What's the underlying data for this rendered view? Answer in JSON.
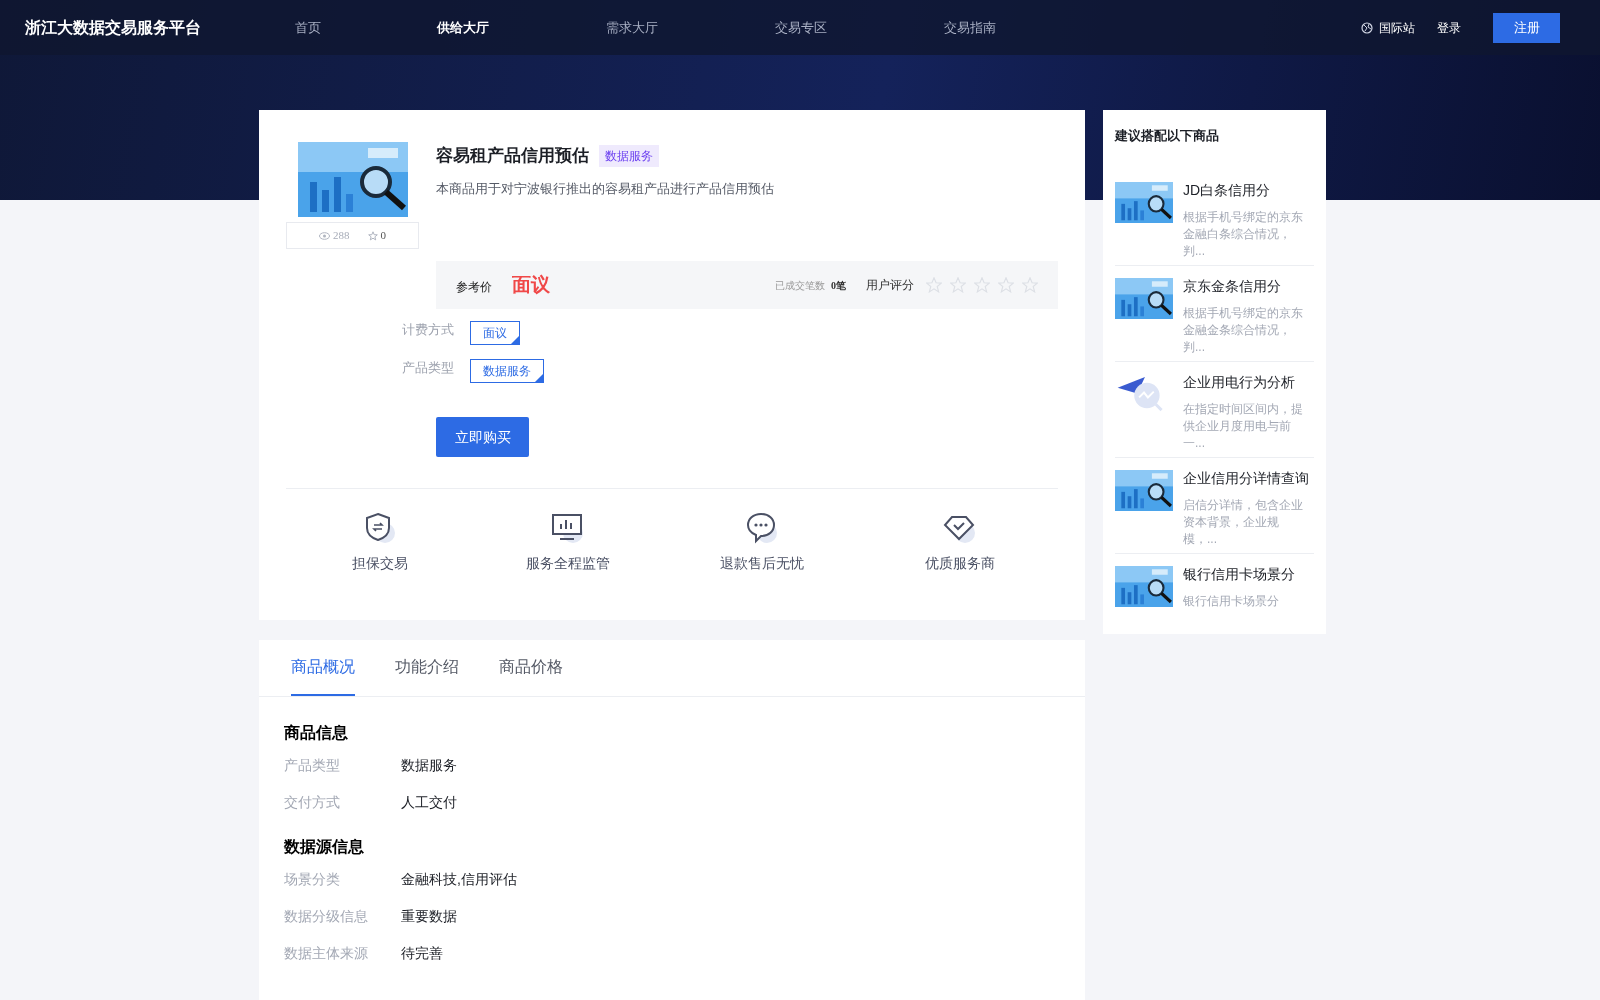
{
  "header": {
    "logo": "浙江大数据交易服务平台",
    "nav": [
      {
        "label": "首页",
        "selected": false
      },
      {
        "label": "供给大厅",
        "selected": true
      },
      {
        "label": "需求大厅",
        "selected": false
      },
      {
        "label": "交易专区",
        "selected": false
      },
      {
        "label": "交易指南",
        "selected": false
      }
    ],
    "intl": "国际站",
    "login": "登录",
    "register": "注册"
  },
  "product": {
    "title": "容易租产品信用预估",
    "badge": "数据服务",
    "description": "本商品用于对宁波银行推出的容易租产品进行产品信用预估",
    "views": "288",
    "favorites": "0",
    "price_label": "参考价",
    "price": "面议",
    "deals_label": "已成交笔数",
    "deals": "0笔",
    "rating_label": "用户评分",
    "stars": 0,
    "options": [
      {
        "label": "计费方式",
        "value": "面议"
      },
      {
        "label": "产品类型",
        "value": "数据服务"
      }
    ],
    "buy": "立即购买",
    "features": [
      {
        "kind": "shield",
        "label": "担保交易"
      },
      {
        "kind": "monitor",
        "label": "服务全程监管"
      },
      {
        "kind": "chat",
        "label": "退款售后无忧"
      },
      {
        "kind": "diamond",
        "label": "优质服务商"
      }
    ]
  },
  "tabs": [
    {
      "label": "商品概况",
      "selected": true
    },
    {
      "label": "功能介绍",
      "selected": false
    },
    {
      "label": "商品价格",
      "selected": false
    }
  ],
  "sections": [
    {
      "title": "商品信息",
      "rows": [
        {
          "label": "产品类型",
          "value": "数据服务"
        },
        {
          "label": "交付方式",
          "value": "人工交付"
        }
      ]
    },
    {
      "title": "数据源信息",
      "rows": [
        {
          "label": "场景分类",
          "value": "金融科技,信用评估"
        },
        {
          "label": "数据分级信息",
          "value": "重要数据"
        },
        {
          "label": "数据主体来源",
          "value": "待完善"
        }
      ]
    }
  ],
  "sidebar": {
    "title": "建议搭配以下商品",
    "items": [
      {
        "name": "JD白条信用分",
        "description": "根据手机号绑定的京东金融白条综合情况，判..."
      },
      {
        "name": "京东金条信用分",
        "description": "根据手机号绑定的京东金融金条综合情况，判..."
      },
      {
        "kind": "illustration",
        "name": "企业用电行为分析",
        "description": "在指定时间区间内，提供企业月度用电与前一..."
      },
      {
        "name": "企业信用分详情查询",
        "description": "启信分详情，包含企业资本背景，企业规模，..."
      },
      {
        "name": "银行信用卡场景分",
        "description": "银行信用卡场景分"
      }
    ]
  }
}
